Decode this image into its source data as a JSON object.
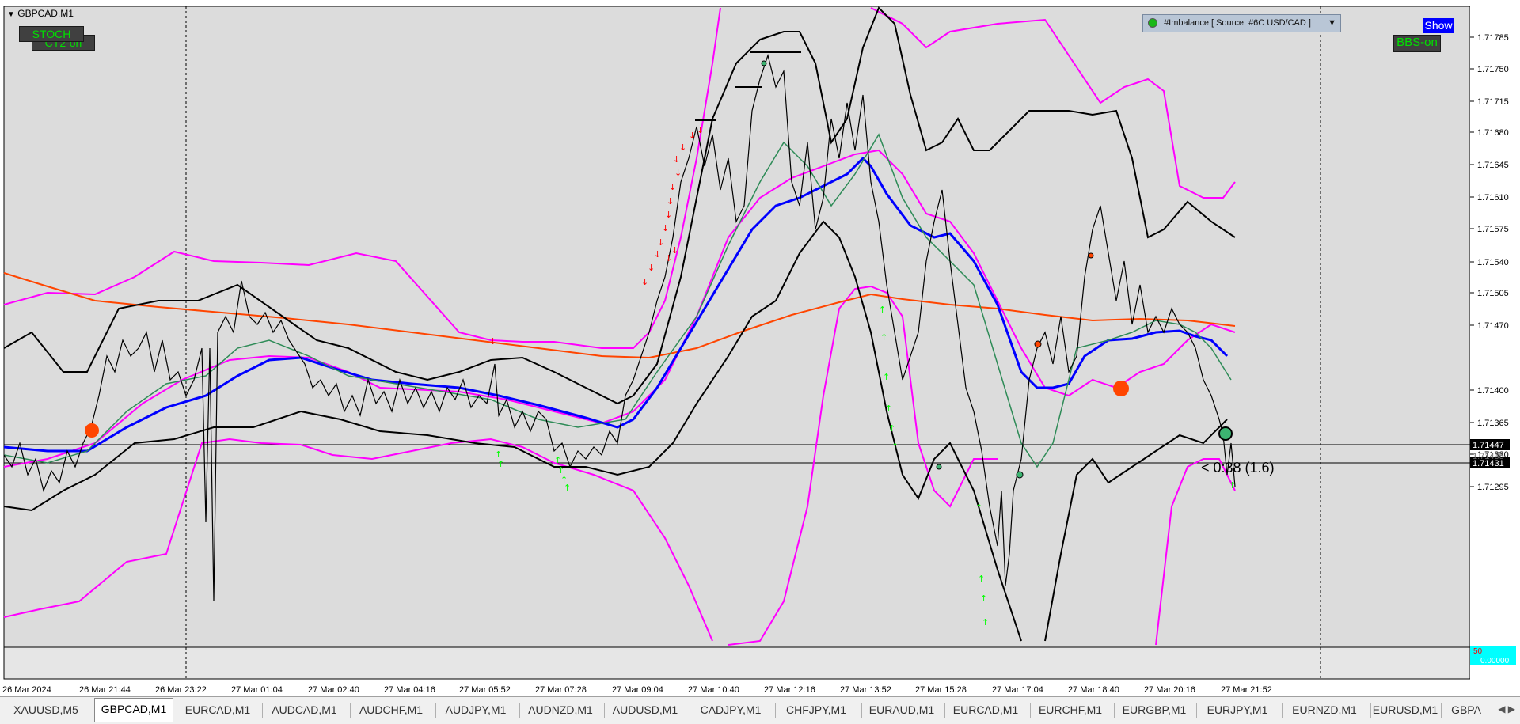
{
  "window": {
    "symbol_title": "GBPCAD,M1",
    "symbol_arrow": "▼"
  },
  "indicators": {
    "stoch_label": "STOCH",
    "ct2_label": "CT2-on",
    "bbs_label": "BBS-on",
    "show_label": "Show",
    "imbalance_label": "#Imbalance [ Source: #6C USD/CAD ]",
    "imbalance_dropdown": "▼"
  },
  "price_axis": {
    "labels": [
      "1.71785",
      "1.71750",
      "1.71715",
      "1.71680",
      "1.71645",
      "1.71610",
      "1.71575",
      "1.71540",
      "1.71505",
      "1.71470",
      "1.71400",
      "1.71365",
      "1.71330",
      "1.71295"
    ],
    "current_bid": "1.71447",
    "current_ask": "1.71431",
    "overlap_label": "1.71435",
    "sub_label_a": "50",
    "sub_label_b": "0.00000"
  },
  "time_axis": {
    "labels": [
      "26 Mar 2024",
      "26 Mar 21:44",
      "26 Mar 23:22",
      "27 Mar 01:04",
      "27 Mar 02:40",
      "27 Mar 04:16",
      "27 Mar 05:52",
      "27 Mar 07:28",
      "27 Mar 09:04",
      "27 Mar 10:40",
      "27 Mar 12:16",
      "27 Mar 13:52",
      "27 Mar 15:28",
      "27 Mar 17:04",
      "27 Mar 18:40",
      "27 Mar 20:16",
      "27 Mar 21:52"
    ]
  },
  "annotation": "< 0:38 (1.6)",
  "colors": {
    "chart_bg": "#dcdcdc",
    "price_line": "#000000",
    "bollinger_outer": "#ff00ff",
    "ma_blue": "#0000ff",
    "ma_green": "#2e8b57",
    "ma_orange": "#ff4500",
    "up_arrow": "#00ff00",
    "down_arrow": "#ff0000",
    "label_green": "#00e000"
  },
  "tabs": [
    {
      "label": "XAUUSD,M5",
      "active": false
    },
    {
      "label": "GBPCAD,M1",
      "active": true
    },
    {
      "label": "EURCAD,M1",
      "active": false
    },
    {
      "label": "AUDCAD,M1",
      "active": false
    },
    {
      "label": "AUDCHF,M1",
      "active": false
    },
    {
      "label": "AUDJPY,M1",
      "active": false
    },
    {
      "label": "AUDNZD,M1",
      "active": false
    },
    {
      "label": "AUDUSD,M1",
      "active": false
    },
    {
      "label": "CADJPY,M1",
      "active": false
    },
    {
      "label": "CHFJPY,M1",
      "active": false
    },
    {
      "label": "EURAUD,M1",
      "active": false
    },
    {
      "label": "EURCAD,M1",
      "active": false
    },
    {
      "label": "EURCHF,M1",
      "active": false
    },
    {
      "label": "EURGBP,M1",
      "active": false
    },
    {
      "label": "EURJPY,M1",
      "active": false
    },
    {
      "label": "EURNZD,M1",
      "active": false
    },
    {
      "label": "EURUSD,M1",
      "active": false
    },
    {
      "label": "GBPA",
      "active": false
    }
  ],
  "tab_scroll": "◀ ▶"
}
